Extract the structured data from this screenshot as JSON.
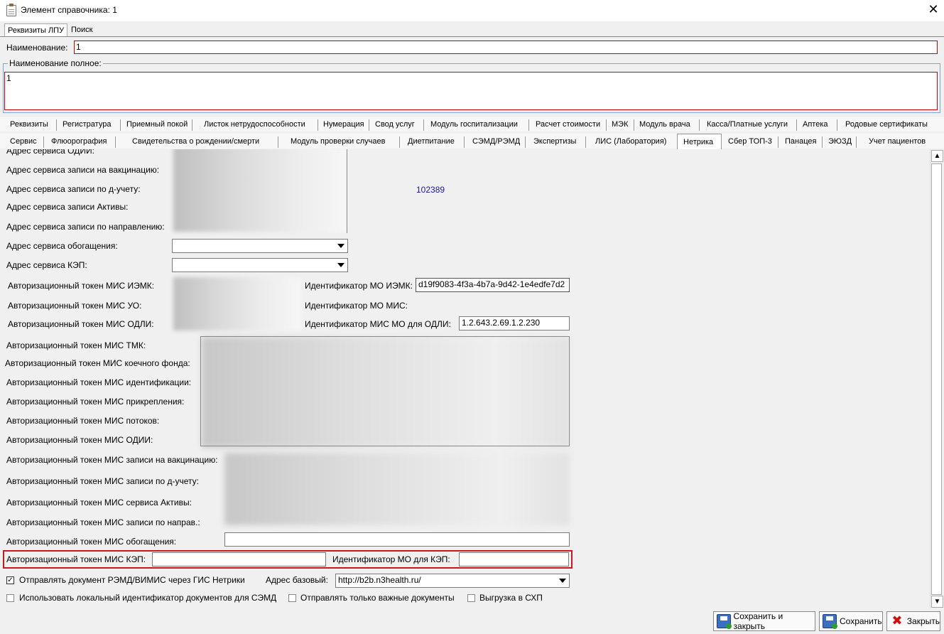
{
  "window": {
    "title": "Элемент справочника: 1",
    "close_glyph": "✕"
  },
  "top_tabs": [
    "Реквизиты ЛПУ",
    "Поиск"
  ],
  "name_label": "Наименование:",
  "name_value": "1",
  "fullname_label": "Наименование полное:",
  "fullname_value": "1",
  "tabs_row1": [
    "Реквизиты",
    "Регистратура",
    "Приемный покой",
    "Листок нетрудоспособности",
    "Нумерация",
    "Свод услуг",
    "Модуль госпитализации",
    "Расчет стоимости",
    "МЭК",
    "Модуль врача",
    "Касса/Платные услуги",
    "Аптека",
    "Родовые сертификаты"
  ],
  "tabs_row2": [
    "Сервис",
    "Флюорография",
    "Свидетельства о рождении/смерти",
    "Модуль проверки случаев",
    "Диетпитание",
    "СЭМД/РЭМД",
    "Экспертизы",
    "ЛИС (Лаборатория)",
    "Нетрика",
    "Сбер ТОП-3",
    "Панацея",
    "ЭЮЗД",
    "Учет пациентов"
  ],
  "active_tab": "Нетрика",
  "fields": {
    "odii_addr": "Адрес сервиса ОДИИ:",
    "vacc_addr": "Адрес сервиса записи на вакцинацию:",
    "d_addr": "Адрес сервиса записи по д-учету:",
    "active_addr": "Адрес сервиса записи Активы:",
    "napr_addr": "Адрес сервиса записи по направлению:",
    "enrich_addr": "Адрес сервиса обогащения:",
    "kep_addr": "Адрес сервиса КЭП:",
    "token_iemk": "Авторизационный токен МИС ИЭМК:",
    "token_uo": "Авторизационный токен МИС УО:",
    "token_odli": "Авторизационный токен МИС ОДЛИ:",
    "id_iemk_label": "Идентификатор МО ИЭМК:",
    "id_iemk_value": "d19f9083-4f3a-4b7a-9d42-1e4edfe7d2",
    "id_mis_label": "Идентификатор МО МИС:",
    "id_odli_label": "Идентификатор МИС МО для ОДЛИ:",
    "id_odli_value": "1.2.643.2.69.1.2.230",
    "token_tmk": "Авторизационный токен МИС ТМК:",
    "token_bed": "Авторизационный токен МИС коечного фонда:",
    "token_ident": "Авторизационный токен МИС идентификации:",
    "token_attach": "Авторизационный токен МИС прикрепления:",
    "token_flows": "Авторизационный токен МИС потоков:",
    "token_odii": "Авторизационный токен МИС ОДИИ:",
    "token_vacc": "Авторизационный токен МИС записи на вакцинацию:",
    "token_d": "Авторизационный токен МИС записи по д-учету:",
    "token_active": "Авторизационный токен МИС сервиса Активы:",
    "token_napr": "Авторизационный токен МИС записи по направ.:",
    "token_enrich": "Авторизационный токен МИС обогащения:",
    "token_kep": "Авторизационный токен МИС КЭП:",
    "id_kep_label": "Идентификатор МО для КЭП:",
    "code_number": "102389"
  },
  "checkboxes": {
    "send_remd": "Отправлять документ РЭМД/ВИМИС через ГИС Нетрики",
    "local_id": "Использовать локальный идентификатор документов для СЭМД",
    "important_only": "Отправлять только важные документы",
    "export_shp": "Выгрузка в СХП"
  },
  "base_addr_label": "Адрес базовый:",
  "base_addr_value": "http://b2b.n3health.ru/",
  "buttons": {
    "save_close": "Сохранить и закрыть",
    "save": "Сохранить",
    "close": "Закрыть"
  }
}
